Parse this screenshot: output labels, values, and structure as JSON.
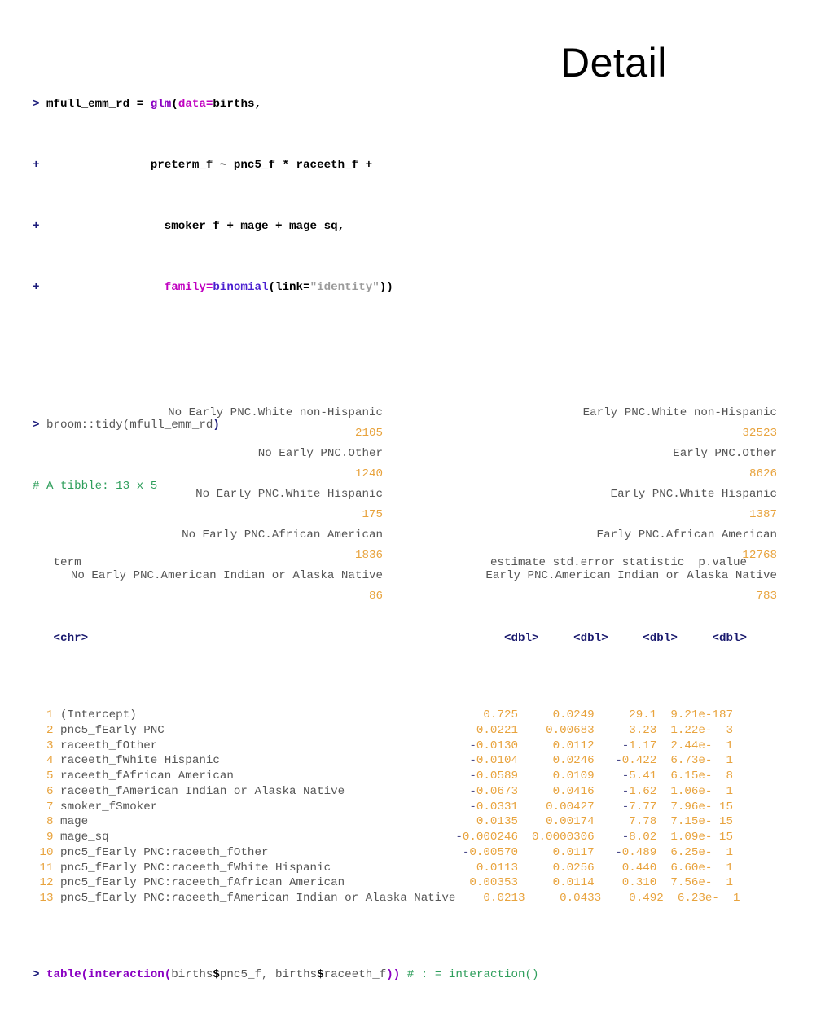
{
  "slide": {
    "title": "Detail"
  },
  "console": {
    "model_call": {
      "prompt": ">",
      "line1_var": " mfull_emm_rd = ",
      "line1_fn": "glm",
      "line1_open": "(",
      "line1_arg": "data",
      "line1_eq": "=",
      "line1_rest": "births,",
      "cont_prompt": "+",
      "line2": "                preterm_f ~ pnc5_f * raceeth_f +",
      "line3": "                  smoker_f + mage + mage_sq,",
      "line4_indent": "                  ",
      "line4_family": "family",
      "line4_eq": "=",
      "line4_binomial": "binomial",
      "line4_open": "(",
      "line4_link": "link=",
      "line4_str": "\"identity\"",
      "line4_close": "))"
    },
    "tidy_call": {
      "prompt": ">",
      "text": " broom::tidy(mfull_emm_rd",
      "close": ")"
    },
    "tibble_info": "# A tibble: 13 x 5",
    "table_call": {
      "prompt": ">",
      "table_fn": "table",
      "open1": "(",
      "interaction_fn": "interaction",
      "open2": "(",
      "arg1a": "births",
      "dollar1": "$",
      "arg1b": "pnc5_f, ",
      "arg2a": "births",
      "dollar2": "$",
      "arg2b": "raceeth_f",
      "close": "))",
      "comment": " # : = interaction()"
    }
  },
  "tibble": {
    "headers": {
      "term": "term",
      "estimate": "estimate",
      "std_error": "std.error",
      "statistic": "statistic",
      "p_value": "p.value"
    },
    "dtypes": {
      "term": "<chr>",
      "estimate": "<dbl>",
      "std_error": "<dbl>",
      "statistic": "<dbl>",
      "p_value": "<dbl>"
    },
    "rows": [
      {
        "n": "1",
        "term": "(Intercept)",
        "estimate": "0.725",
        "std_error": "0.0249",
        "statistic": "29.1",
        "p_value": "9.21e-187"
      },
      {
        "n": "2",
        "term": "pnc5_fEarly PNC",
        "estimate": "0.0221",
        "std_error": "0.00683",
        "statistic": "3.23",
        "p_value": "1.22e-  3"
      },
      {
        "n": "3",
        "term": "raceeth_fOther",
        "estimate": "-0.0130",
        "std_error": "0.0112",
        "statistic": "-1.17",
        "p_value": "2.44e-  1"
      },
      {
        "n": "4",
        "term": "raceeth_fWhite Hispanic",
        "estimate": "-0.0104",
        "std_error": "0.0246",
        "statistic": "-0.422",
        "p_value": "6.73e-  1"
      },
      {
        "n": "5",
        "term": "raceeth_fAfrican American",
        "estimate": "-0.0589",
        "std_error": "0.0109",
        "statistic": "-5.41",
        "p_value": "6.15e-  8"
      },
      {
        "n": "6",
        "term": "raceeth_fAmerican Indian or Alaska Native",
        "estimate": "-0.0673",
        "std_error": "0.0416",
        "statistic": "-1.62",
        "p_value": "1.06e-  1"
      },
      {
        "n": "7",
        "term": "smoker_fSmoker",
        "estimate": "-0.0331",
        "std_error": "0.00427",
        "statistic": "-7.77",
        "p_value": "7.96e- 15"
      },
      {
        "n": "8",
        "term": "mage",
        "estimate": "0.0135",
        "std_error": "0.00174",
        "statistic": "7.78",
        "p_value": "7.15e- 15"
      },
      {
        "n": "9",
        "term": "mage_sq",
        "estimate": "-0.000246",
        "std_error": "0.0000306",
        "statistic": "-8.02",
        "p_value": "1.09e- 15"
      },
      {
        "n": "10",
        "term": "pnc5_fEarly PNC:raceeth_fOther",
        "estimate": "-0.00570",
        "std_error": "0.0117",
        "statistic": "-0.489",
        "p_value": "6.25e-  1"
      },
      {
        "n": "11",
        "term": "pnc5_fEarly PNC:raceeth_fWhite Hispanic",
        "estimate": "0.0113",
        "std_error": "0.0256",
        "statistic": "0.440",
        "p_value": "6.60e-  1"
      },
      {
        "n": "12",
        "term": "pnc5_fEarly PNC:raceeth_fAfrican American",
        "estimate": "0.00353",
        "std_error": "0.0114",
        "statistic": "0.310",
        "p_value": "7.56e-  1"
      },
      {
        "n": "13",
        "term": "pnc5_fEarly PNC:raceeth_fAmerican Indian or Alaska Native",
        "estimate": "0.0213",
        "std_error": "0.0433",
        "statistic": "0.492",
        "p_value": "6.23e-  1"
      }
    ]
  },
  "crosstab": {
    "rows": [
      {
        "left_label": "No Early PNC.White non-Hispanic",
        "left_count": "2105",
        "right_label": "Early PNC.White non-Hispanic",
        "right_count": "32523"
      },
      {
        "left_label": "No Early PNC.Other",
        "left_count": "1240",
        "right_label": "Early PNC.Other",
        "right_count": "8626"
      },
      {
        "left_label": "No Early PNC.White Hispanic",
        "left_count": "175",
        "right_label": "Early PNC.White Hispanic",
        "right_count": "1387"
      },
      {
        "left_label": "No Early PNC.African American",
        "left_count": "1836",
        "right_label": "Early PNC.African American",
        "right_count": "12768"
      },
      {
        "left_label": "No Early PNC.American Indian or Alaska Native",
        "left_count": "86",
        "right_label": "Early PNC.American Indian or Alaska Native",
        "right_count": "783"
      }
    ]
  },
  "colors": {
    "prompt": "#1a1a7a",
    "function": "#8a00c2",
    "argument": "#c000c0",
    "string": "#9b9b9b",
    "comment": "#2e9e5b",
    "number": "#e8a33d",
    "negative": "#4a4a8a",
    "dtype": "#1a1a6e",
    "text": "#555555",
    "background": "#ffffff"
  }
}
